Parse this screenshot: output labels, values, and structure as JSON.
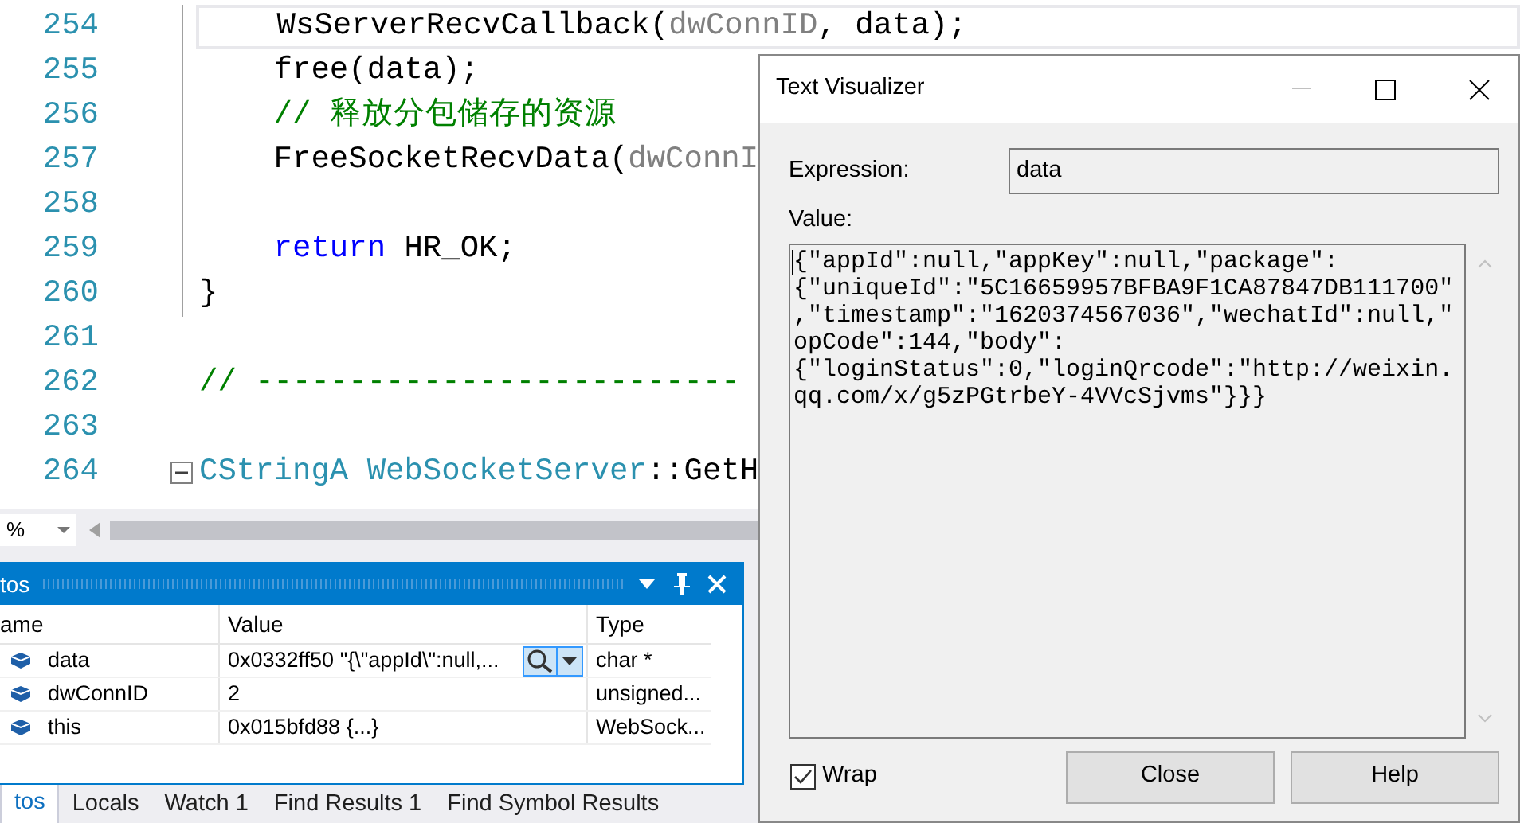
{
  "editor": {
    "lines": [
      {
        "number": "254",
        "current": true,
        "kind": "scope",
        "tokens": [
          {
            "kind": "plain",
            "text": "    WsServerRecvCallback("
          },
          {
            "kind": "param",
            "text": "dwConnID"
          },
          {
            "kind": "plain",
            "text": ", data);"
          }
        ]
      },
      {
        "number": "255",
        "current": false,
        "kind": "scope",
        "tokens": [
          {
            "kind": "plain",
            "text": "    free(data);"
          }
        ]
      },
      {
        "number": "256",
        "current": false,
        "kind": "scope",
        "tokens": [
          {
            "kind": "comment",
            "text": "    // 释放分包储存的资源"
          }
        ]
      },
      {
        "number": "257",
        "current": false,
        "kind": "scope",
        "tokens": [
          {
            "kind": "plain",
            "text": "    FreeSocketRecvData("
          },
          {
            "kind": "param",
            "text": "dwConnI"
          }
        ]
      },
      {
        "number": "258",
        "current": false,
        "kind": "scope"
      },
      {
        "number": "259",
        "current": false,
        "kind": "scope",
        "tokens": [
          {
            "kind": "keyword",
            "text": "    return"
          },
          {
            "kind": "plain",
            "text": " HR_OK;"
          }
        ]
      },
      {
        "number": "260",
        "current": false,
        "kind": "scope",
        "tokens": [
          {
            "kind": "plain",
            "text": "}"
          }
        ]
      },
      {
        "number": "261",
        "current": false,
        "kind": "plain"
      },
      {
        "number": "262",
        "current": false,
        "kind": "plain",
        "tokens": [
          {
            "kind": "comment",
            "text": "// --------------------------"
          }
        ]
      },
      {
        "number": "263",
        "current": false,
        "kind": "plain"
      },
      {
        "number": "264",
        "current": false,
        "kind": "fold",
        "tokens": [
          {
            "kind": "type",
            "text": "CStringA"
          },
          {
            "kind": "type",
            "text": " WebSocketServer"
          },
          {
            "kind": "plain",
            "text": "::GetH"
          }
        ]
      }
    ],
    "zoom": "%"
  },
  "autos": {
    "title": "tos",
    "columns": [
      "ame",
      "Value",
      "Type"
    ],
    "rows": [
      {
        "name": "data",
        "value": "0x0332ff50 \"{\\\"appId\\\":null,...",
        "type": "char *",
        "visualizer": true
      },
      {
        "name": "dwConnID",
        "value": "2",
        "type": "unsigned...",
        "visualizer": false
      },
      {
        "name": "this",
        "value": "0x015bfd88 {...}",
        "type": "WebSock...",
        "visualizer": false
      }
    ]
  },
  "bottom_tabs": [
    {
      "label": "tos",
      "selected": true
    },
    {
      "label": "Locals",
      "selected": false
    },
    {
      "label": "Watch 1",
      "selected": false
    },
    {
      "label": "Find Results 1",
      "selected": false
    },
    {
      "label": "Find Symbol Results",
      "selected": false
    }
  ],
  "dialog": {
    "title": "Text Visualizer",
    "expression_label": "Expression:",
    "expression": "data",
    "value_label": "Value:",
    "value_lines": [
      "{\"appId\":null,\"appKey\":null,\"package\":",
      "{\"uniqueId\":\"5C16659957BFBA9F1CA87847DB111700\"",
      ",\"timestamp\":\"1620374567036\",\"wechatId\":null,\"",
      "opCode\":144,\"body\":",
      "{\"loginStatus\":0,\"loginQrcode\":\"http://weixin.",
      "qq.com/x/g5zPGtrbeY-4VVcSjvms\"}}}"
    ],
    "wrap": {
      "label": "Wrap",
      "checked": true
    },
    "buttons": [
      "Close",
      "Help"
    ]
  }
}
